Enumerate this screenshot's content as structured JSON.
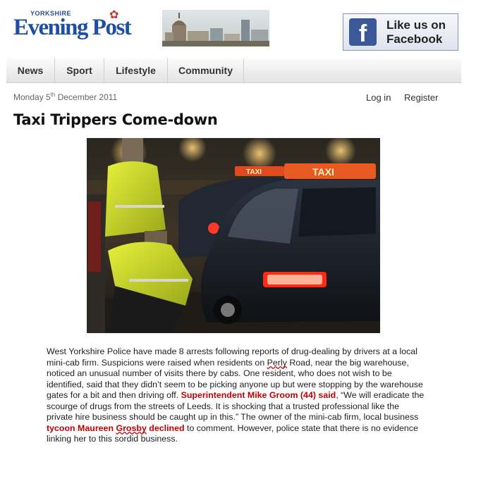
{
  "header": {
    "logo_top": "YORKSHIRE",
    "logo_main": "Evening Post",
    "facebook_label": "Like us on Facebook"
  },
  "nav": {
    "items": [
      {
        "label": "News"
      },
      {
        "label": "Sport"
      },
      {
        "label": "Lifestyle"
      },
      {
        "label": "Community"
      }
    ]
  },
  "meta": {
    "date_prefix": "Monday 5",
    "date_sup": "th",
    "date_suffix": " December 2011",
    "login_label": "Log in",
    "register_label": "Register"
  },
  "article": {
    "title": "Taxi Trippers Come-down",
    "photo_sign_1": "TAXI",
    "photo_sign_2": "TAXI",
    "p1": "West Yorkshire Police have made 8 arrests following reports of drug-dealing by drivers at a local mini-cab firm.  Suspicions were raised when residents on ",
    "p1_sq": "Perly",
    "p2": " Road, near the big warehouse, noticed an unusual number of visits there by cabs.  One resident, who does not wish to be identified, said that they didn’t seem to be picking anyone up but were stopping by the warehouse gates for a bit and then driving off.  ",
    "red1": "Superintendent Mike Groom (44) said",
    "p3": ", “We will eradicate the scourge of drugs from the streets of Leeds.  It is shocking that a trusted professional like the private hire business should be caught up in this.” The owner of the mini-cab firm, local business ",
    "red2a": "tycoon Maureen ",
    "red2_sq": "Grosby",
    "red2b": " declined",
    "p4": " to comment.  However, police state that there is no evidence linking her to this sordid business."
  },
  "colors": {
    "brand_blue": "#1d4fa3",
    "facebook_blue": "#3b5998",
    "highlight_red": "#c00000"
  }
}
